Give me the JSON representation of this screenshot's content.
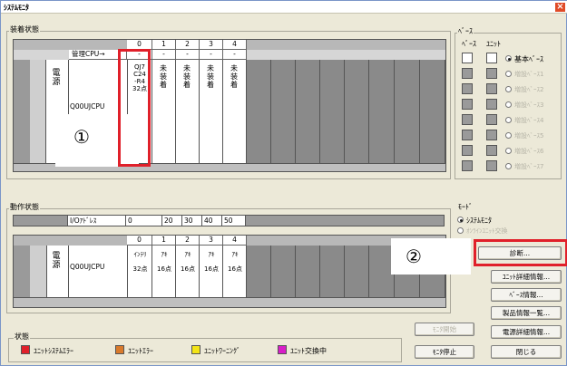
{
  "window": {
    "title": "ｼｽﾃﾑﾓﾆﾀ",
    "close_label": "×"
  },
  "install": {
    "label": "装着状態",
    "slot_numbers": [
      "0",
      "1",
      "2",
      "3",
      "4"
    ],
    "row_label": "管理CPU→",
    "dash": "-",
    "power": "電源",
    "cpu": "Q00UJCPU",
    "slot0": [
      "QJ7",
      "C24",
      "-R4",
      "32点"
    ],
    "not_installed": "未装着",
    "annotation": "①"
  },
  "base": {
    "label": "ﾍﾞｰｽ",
    "col_base": "ﾍﾞｰｽ",
    "col_unit": "ﾕﾆｯﾄ",
    "options": [
      "基本ﾍﾞｰｽ",
      "増設ﾍﾞｰｽ1",
      "増設ﾍﾞｰｽ2",
      "増設ﾍﾞｰｽ3",
      "増設ﾍﾞｰｽ4",
      "増設ﾍﾞｰｽ5",
      "増設ﾍﾞｰｽ6",
      "増設ﾍﾞｰｽ7"
    ]
  },
  "action": {
    "label": "動作状態",
    "io_label": "I/Oｱﾄﾞﾚｽ",
    "io_values": [
      "0",
      "20",
      "30",
      "40",
      "50"
    ],
    "slot_numbers": [
      "0",
      "1",
      "2",
      "3",
      "4"
    ],
    "power": "電源",
    "cpu": "Q00UJCPU",
    "types": [
      "ｲﾝﾃﾘ",
      "ｱｷ",
      "ｱｷ",
      "ｱｷ",
      "ｱｷ"
    ],
    "points": [
      "32点",
      "16点",
      "16点",
      "16点",
      "16点"
    ],
    "annotation": "②"
  },
  "mode": {
    "label": "ﾓｰﾄﾞ",
    "option1": "ｼｽﾃﾑﾓﾆﾀ",
    "option2": "ｵﾝﾗｲﾝﾕﾆｯﾄ交換"
  },
  "buttons": {
    "diag": "診断...",
    "unit_detail": "ﾕﾆｯﾄ詳細情報...",
    "base_info": "ﾍﾞｰｽ情報...",
    "product_list": "製品情報一覧...",
    "power_detail": "電源詳細情報...",
    "monitor_start": "ﾓﾆﾀ開始",
    "monitor_stop": "ﾓﾆﾀ停止",
    "close": "閉じる"
  },
  "status": {
    "label": "状態",
    "items": [
      {
        "label": "ﾕﾆｯﾄｼｽﾃﾑｴﾗｰ",
        "color": "#e0202a"
      },
      {
        "label": "ﾕﾆｯﾄｴﾗｰ",
        "color": "#d97a2c"
      },
      {
        "label": "ﾕﾆｯﾄﾜｰﾆﾝｸﾞ",
        "color": "#f3e417"
      },
      {
        "label": "ﾕﾆｯﾄ交換中",
        "color": "#d81ec8"
      }
    ]
  }
}
